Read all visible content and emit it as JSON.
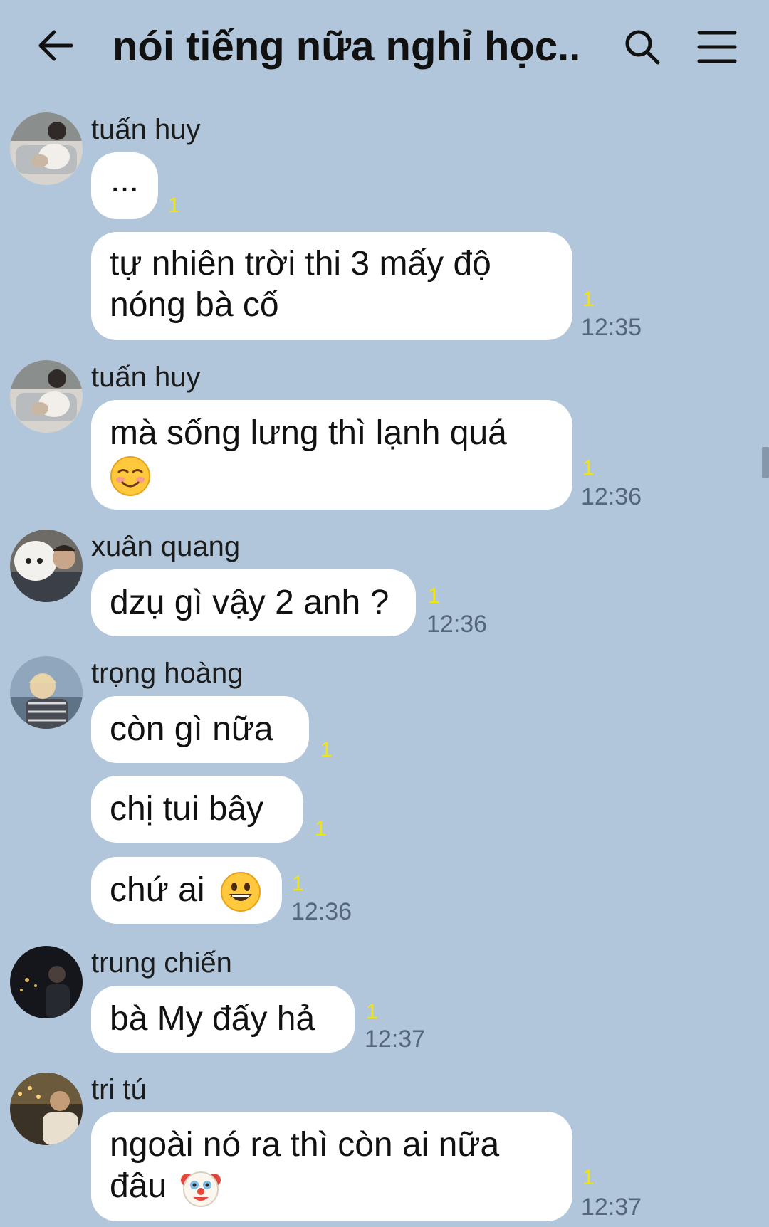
{
  "header": {
    "title": "nói tiếng nữa nghỉ học...",
    "back_icon": "arrow-left-icon",
    "search_icon": "search-icon",
    "menu_icon": "hamburger-menu-icon"
  },
  "messages": [
    {
      "sender": "tuấn huy",
      "bubbles": [
        {
          "text": "...",
          "read": "1"
        }
      ]
    },
    {
      "bubbles": [
        {
          "text_line1": "tự nhiên trời thi 3 mấy độ",
          "text_line2": "nóng bà cố",
          "read": "1",
          "time": "12:35"
        }
      ]
    },
    {
      "sender": "tuấn huy",
      "bubbles": [
        {
          "text_line1": "mà sống lưng thì lạnh quá",
          "emoji": "smiling-blush-emoji",
          "read": "1",
          "time": "12:36"
        }
      ]
    },
    {
      "sender": "xuân quang",
      "bubbles": [
        {
          "text": "dzụ gì vậy 2 anh ?",
          "read": "1",
          "time": "12:36"
        }
      ]
    },
    {
      "sender": "trọng hoàng",
      "bubbles": [
        {
          "text": "còn gì nữa",
          "read": "1"
        },
        {
          "text": "chị tui bây",
          "read": "1"
        },
        {
          "text": "chứ ai",
          "emoji": "grinning-face-emoji",
          "read": "1",
          "time": "12:36"
        }
      ]
    },
    {
      "sender": "trung chiến",
      "bubbles": [
        {
          "text": "bà My đấy hả",
          "read": "1",
          "time": "12:37"
        }
      ]
    },
    {
      "sender": "tri tú",
      "bubbles": [
        {
          "text_line1": "ngoài nó ra thì còn ai nữa",
          "text_line2": "đâu",
          "emoji": "clown-face-emoji",
          "read": "1",
          "time": "12:37"
        }
      ]
    }
  ],
  "colors": {
    "background": "#b1c6da",
    "bubble": "#ffffff",
    "read_count": "#f3e600",
    "time": "#56667a"
  }
}
